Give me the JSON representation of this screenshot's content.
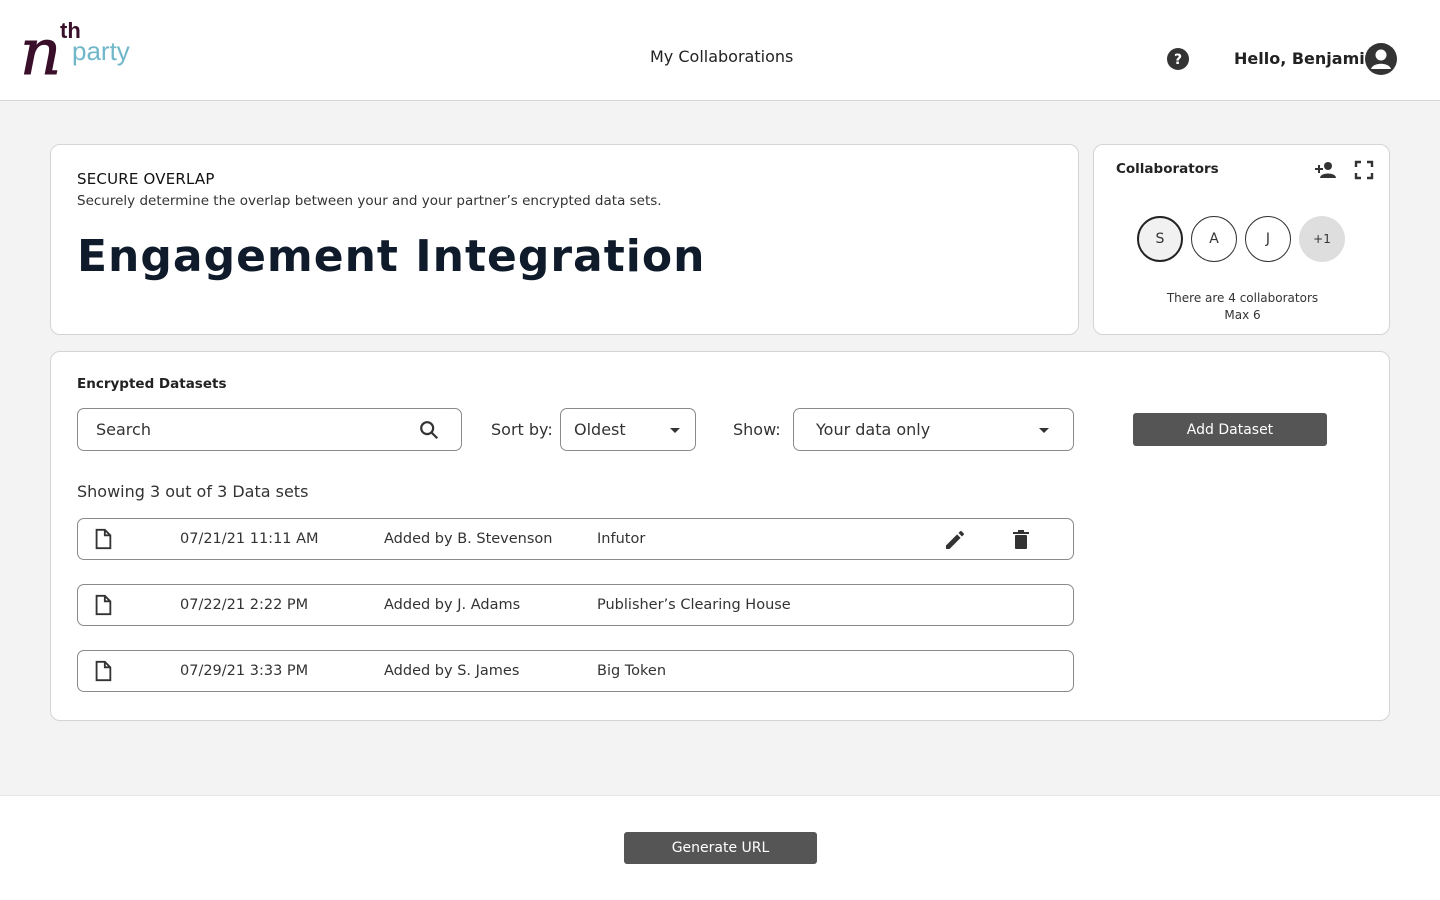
{
  "header": {
    "logo": {
      "main": "n",
      "sup": "th",
      "party": "party",
      "primary_color": "#3a0f2a",
      "accent_color": "#6fb7c9"
    },
    "nav_link": "My Collaborations",
    "greeting": "Hello, Benjamin",
    "icons": {
      "help": "help-circle-icon",
      "user": "account-circle-icon"
    }
  },
  "overview": {
    "eyebrow": "SECURE OVERLAP",
    "subtitle": "Securely determine the overlap between your and your partner’s encrypted data sets.",
    "title": "Engagement Integration"
  },
  "collaborators": {
    "title": "Collaborators",
    "avatars": [
      {
        "initial": "S",
        "active": true
      },
      {
        "initial": "A",
        "active": false
      },
      {
        "initial": "J",
        "active": false
      },
      {
        "initial": "+1",
        "active": false
      }
    ],
    "count_text": "There are 4 collaborators",
    "max_text": "Max 6",
    "icons": {
      "add": "person-add-icon",
      "expand": "fullscreen-icon"
    }
  },
  "datasets": {
    "title": "Encrypted Datasets",
    "search": {
      "placeholder": "Search",
      "value": ""
    },
    "sort_label": "Sort by:",
    "sort_value": "Oldest",
    "show_label": "Show:",
    "show_value": "Your data only",
    "add_button": "Add Dataset",
    "showing_text": "Showing 3 out of 3 Data sets",
    "rows": [
      {
        "date": "07/21/21 11:11 AM",
        "added_by": "Added by B. Stevenson",
        "source": "Infutor"
      },
      {
        "date": "07/22/21 2:22 PM",
        "added_by": "Added by J. Adams",
        "source": "Publisher’s Clearing House"
      },
      {
        "date": "07/29/21 3:33 PM",
        "added_by": "Added by S. James",
        "source": "Big Token"
      }
    ]
  },
  "footer": {
    "generate_button": "Generate URL"
  },
  "colors": {
    "button_bg": "#555555",
    "page_bg": "#f3f3f3",
    "title": "#0f1a2a"
  }
}
